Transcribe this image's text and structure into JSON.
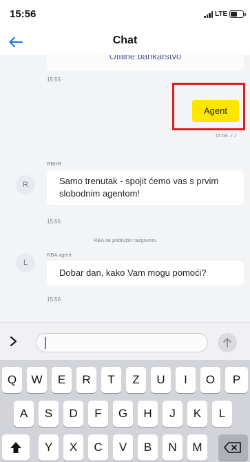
{
  "status_bar": {
    "time": "15:56",
    "network": "LTE"
  },
  "header": {
    "title": "Chat"
  },
  "chat": {
    "top_card_text": "Offline bankarstvo",
    "time_1": "15:55",
    "user_message": "Agent",
    "user_message_meta": "15:56 ✓✓",
    "bot_sender": "RBHR",
    "bot_avatar": "R",
    "bot_message": "Samo trenutak - spojit ćemo vas s prvim slobodnim agentom!",
    "time_2": "15:56",
    "system_note": "RBA se pridružio razgovoru",
    "agent_sender": "RBA agent",
    "agent_avatar": "L",
    "agent_message": "Dobar dan, kako Vam mogu pomoći?",
    "time_3": "15:56"
  },
  "composer": {
    "input_value": "",
    "send_icon": "arrow-up-icon",
    "expand_icon": "chevron-right-icon"
  },
  "keyboard": {
    "row1": [
      "Q",
      "W",
      "E",
      "R",
      "T",
      "Z",
      "U",
      "I",
      "O",
      "P"
    ],
    "row2": [
      "A",
      "S",
      "D",
      "F",
      "G",
      "H",
      "J",
      "K",
      "L"
    ],
    "row3": [
      "Y",
      "X",
      "C",
      "V",
      "B",
      "N",
      "M"
    ],
    "shift_icon": "shift-icon",
    "delete_icon": "backspace-icon"
  },
  "colors": {
    "accent_yellow": "#ffe600",
    "highlight_red": "#e11b22",
    "back_arrow": "#1a73e8",
    "chat_bg": "#f3f4f5"
  }
}
